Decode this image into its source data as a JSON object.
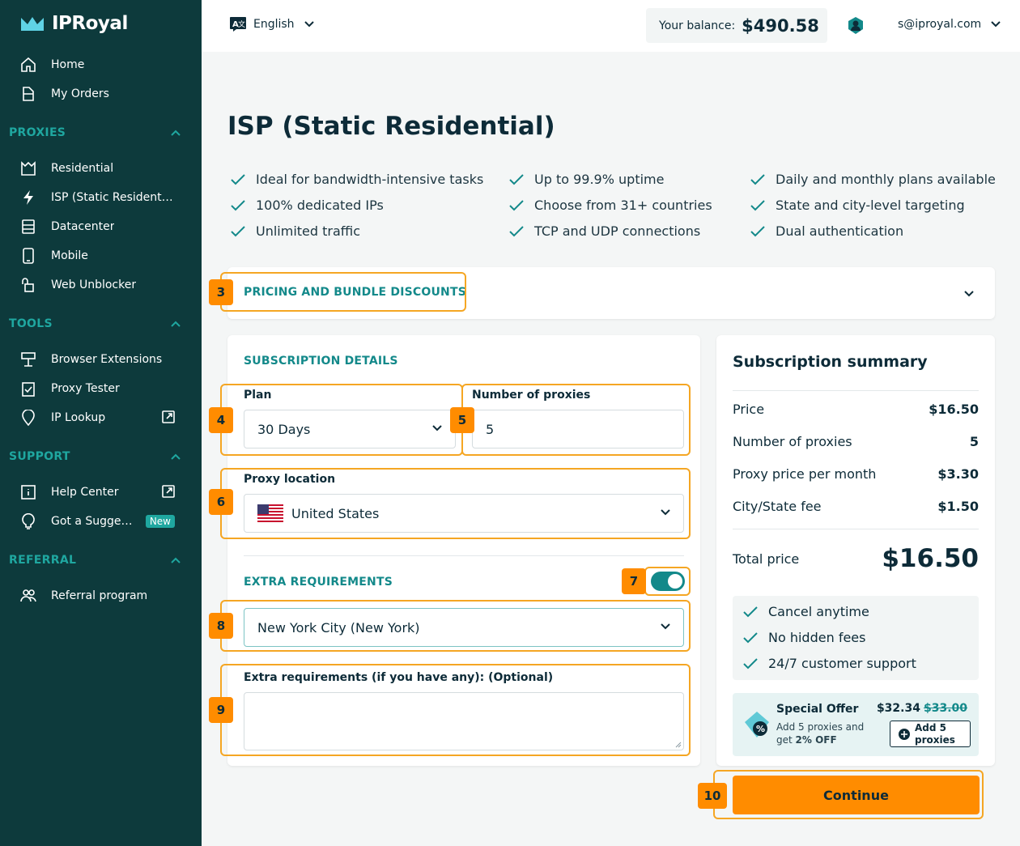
{
  "brand": {
    "name": "IPRoyal"
  },
  "sidebar": {
    "top_items": [
      {
        "label": "Home"
      },
      {
        "label": "My Orders"
      }
    ],
    "sections": [
      {
        "title": "PROXIES",
        "items": [
          {
            "label": "Residential"
          },
          {
            "label": "ISP (Static Residential)"
          },
          {
            "label": "Datacenter"
          },
          {
            "label": "Mobile"
          },
          {
            "label": "Web Unblocker"
          }
        ]
      },
      {
        "title": "TOOLS",
        "items": [
          {
            "label": "Browser Extensions"
          },
          {
            "label": "Proxy Tester"
          },
          {
            "label": "IP Lookup"
          }
        ]
      },
      {
        "title": "SUPPORT",
        "items": [
          {
            "label": "Help Center"
          },
          {
            "label": "Got a Suggestion?",
            "badge": "New"
          }
        ]
      },
      {
        "title": "REFERRAL",
        "items": [
          {
            "label": "Referral program"
          }
        ]
      }
    ]
  },
  "topbar": {
    "language": "English",
    "balance_label": "Your balance:",
    "balance_value": "$490.58",
    "user_email": "s@iproyal.com"
  },
  "page": {
    "title": "ISP (Static Residential)",
    "features": [
      "Ideal for bandwidth-intensive tasks",
      "Up to 99.9% uptime",
      "Daily and monthly plans available",
      "100% dedicated IPs",
      "Choose from 31+ countries",
      "State and city-level targeting",
      "Unlimited traffic",
      "TCP and UDP connections",
      "Dual authentication"
    ],
    "pricing_header": "PRICING AND BUNDLE DISCOUNTS"
  },
  "annotations": [
    "3",
    "4",
    "5",
    "6",
    "7",
    "8",
    "9",
    "10"
  ],
  "subscription": {
    "header": "SUBSCRIPTION DETAILS",
    "plan_label": "Plan",
    "plan_value": "30 Days",
    "proxies_label": "Number of proxies",
    "proxies_value": "5",
    "location_label": "Proxy location",
    "location_value": "United States",
    "extra_header": "EXTRA REQUIREMENTS",
    "extra_enabled": true,
    "city_value": "New York City (New York)",
    "extra_text_label": "Extra requirements (if you have any): (Optional)",
    "extra_text_value": ""
  },
  "summary": {
    "title": "Subscription summary",
    "rows": [
      {
        "label": "Price",
        "value": "$16.50"
      },
      {
        "label": "Number of proxies",
        "value": "5"
      },
      {
        "label": "Proxy price per month",
        "value": "$3.30"
      },
      {
        "label": "City/State fee",
        "value": "$1.50"
      }
    ],
    "total_label": "Total price",
    "total_value": "$16.50",
    "benefits": [
      "Cancel anytime",
      "No hidden fees",
      "24/7 customer support"
    ],
    "offer": {
      "title": "Special Offer",
      "line1": "Add 5 proxies and",
      "line2_prefix": "get ",
      "line2_bold": "2% OFF",
      "price": "$32.34",
      "old_price": "$33.00",
      "button_line1": "Add 5",
      "button_line2": "proxies"
    },
    "continue_label": "Continue"
  },
  "colors": {
    "sidebar": "#0d3a3c",
    "accent": "#13898a",
    "orange": "#ff8c00"
  }
}
